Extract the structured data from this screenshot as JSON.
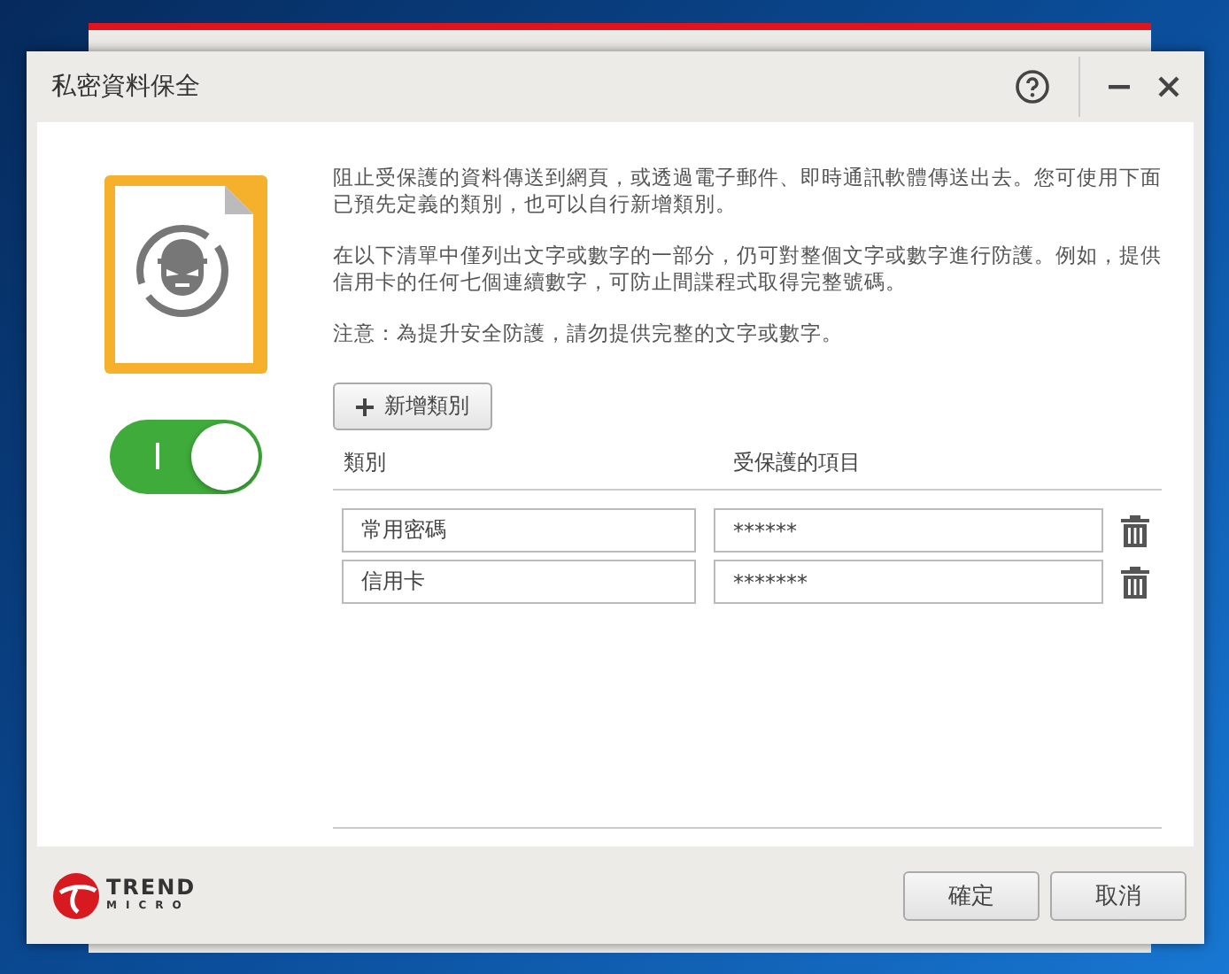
{
  "window": {
    "title": "私密資料保全"
  },
  "toggle": {
    "on": true
  },
  "description": [
    "阻止受保護的資料傳送到網頁，或透過電子郵件、即時通訊軟體傳送出去。您可使用下面已預先定義的類別，也可以自行新增類別。",
    "在以下清單中僅列出文字或數字的一部分，仍可對整個文字或數字進行防護。例如，提供信用卡的任何七個連續數字，可防止間諜程式取得完整號碼。",
    "注意：為提升安全防護，請勿提供完整的文字或數字。"
  ],
  "add_button": {
    "label": "新增類別"
  },
  "table": {
    "columns": [
      "類別",
      "受保護的項目"
    ],
    "rows": [
      {
        "category": "常用密碼",
        "item": "******"
      },
      {
        "category": "信用卡",
        "item": "*******"
      }
    ]
  },
  "logo": {
    "line1": "TREND",
    "line2": "MICRO"
  },
  "buttons": [
    "確定",
    "取消"
  ]
}
